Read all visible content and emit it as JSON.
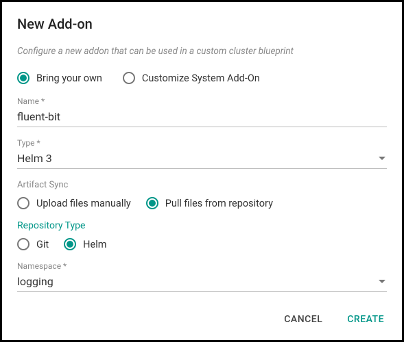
{
  "title": "New Add-on",
  "subtitle": "Configure a new addon that can be used in a custom cluster blueprint",
  "sourceOptions": {
    "byo": "Bring your own",
    "customize": "Customize System Add-On"
  },
  "fields": {
    "name": {
      "label": "Name *",
      "value": "fluent-bit"
    },
    "type": {
      "label": "Type *",
      "value": "Helm 3"
    },
    "namespace": {
      "label": "Namespace *",
      "value": "logging"
    }
  },
  "artifactSync": {
    "label": "Artifact Sync",
    "options": {
      "upload": "Upload files manually",
      "pull": "Pull files from repository"
    }
  },
  "repositoryType": {
    "label": "Repository Type",
    "options": {
      "git": "Git",
      "helm": "Helm"
    }
  },
  "actions": {
    "cancel": "CANCEL",
    "create": "CREATE"
  }
}
